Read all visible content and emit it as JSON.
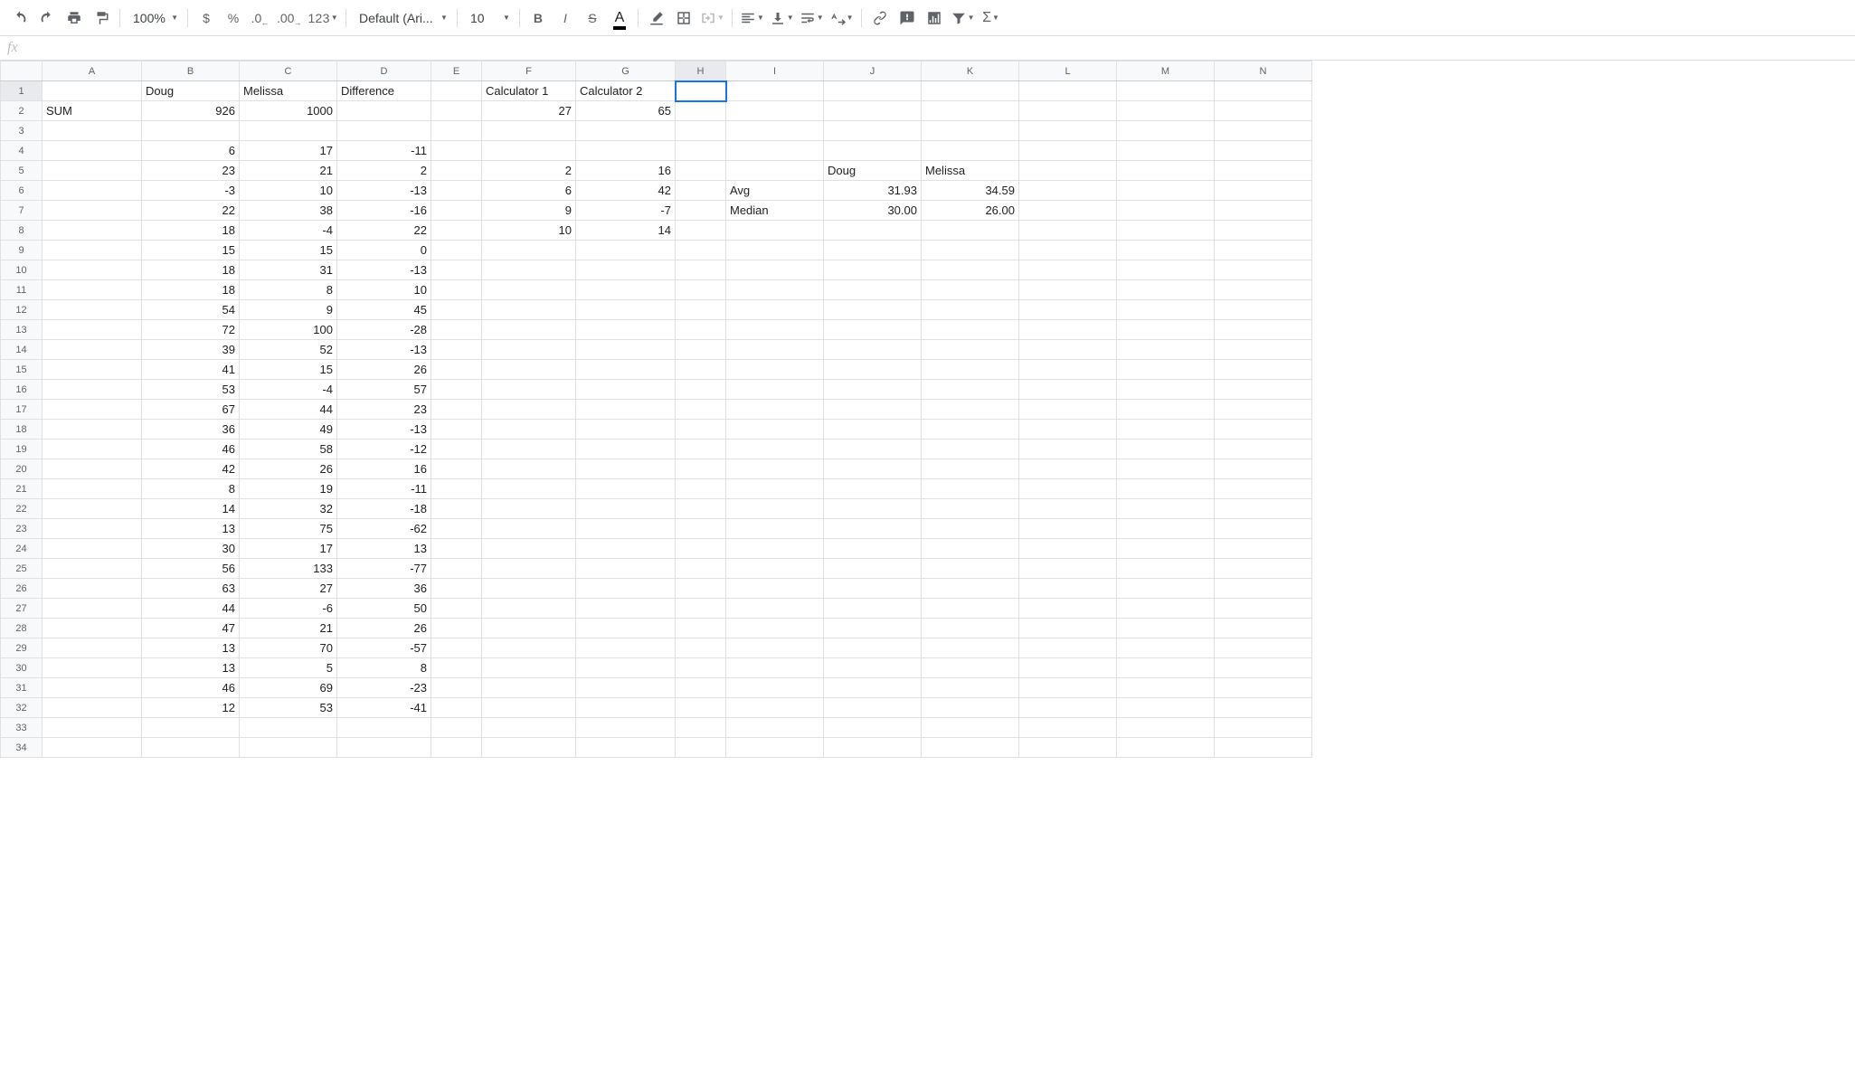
{
  "toolbar": {
    "zoom": "100%",
    "format123": "123",
    "font_name": "Default (Ari...",
    "font_size": "10"
  },
  "formula": {
    "fx_label": "fx",
    "value": ""
  },
  "columns": [
    "A",
    "B",
    "C",
    "D",
    "E",
    "F",
    "G",
    "H",
    "I",
    "J",
    "K",
    "L",
    "M",
    "N"
  ],
  "selected_col": "H",
  "selected_row": "1",
  "rows": [
    {
      "n": "1",
      "A": "",
      "B": "Doug",
      "C": "Melissa",
      "D": "Difference",
      "E": "",
      "F": "Calculator 1",
      "G": "Calculator 2",
      "H": "",
      "I": "",
      "J": "",
      "K": "",
      "L": "",
      "M": "",
      "N": "",
      "bold": [
        "B",
        "C",
        "D",
        "F",
        "G"
      ]
    },
    {
      "n": "2",
      "A": "SUM",
      "B": "926",
      "C": "1000",
      "D": "",
      "E": "",
      "F": "27",
      "G": "65",
      "H": "",
      "I": "",
      "J": "",
      "K": "",
      "L": "",
      "M": "",
      "N": "",
      "bold": [
        "A",
        "B",
        "C"
      ]
    },
    {
      "n": "3"
    },
    {
      "n": "4",
      "B": "6",
      "C": "17",
      "D": "-11"
    },
    {
      "n": "5",
      "B": "23",
      "C": "21",
      "D": "2",
      "F": "2",
      "G": "16",
      "J": "Doug",
      "K": "Melissa",
      "boldL": [
        "J",
        "K"
      ]
    },
    {
      "n": "6",
      "B": "-3",
      "C": "10",
      "D": "-13",
      "F": "6",
      "G": "42",
      "I": "Avg",
      "J": "31.93",
      "K": "34.59",
      "boldL": [
        "I"
      ]
    },
    {
      "n": "7",
      "B": "22",
      "C": "38",
      "D": "-16",
      "F": "9",
      "G": "-7",
      "I": "Median",
      "J": "30.00",
      "K": "26.00",
      "boldL": [
        "I"
      ]
    },
    {
      "n": "8",
      "B": "18",
      "C": "-4",
      "D": "22",
      "F": "10",
      "G": "14"
    },
    {
      "n": "9",
      "B": "15",
      "C": "15",
      "D": "0"
    },
    {
      "n": "10",
      "B": "18",
      "C": "31",
      "D": "-13"
    },
    {
      "n": "11",
      "B": "18",
      "C": "8",
      "D": "10"
    },
    {
      "n": "12",
      "B": "54",
      "C": "9",
      "D": "45"
    },
    {
      "n": "13",
      "B": "72",
      "C": "100",
      "D": "-28"
    },
    {
      "n": "14",
      "B": "39",
      "C": "52",
      "D": "-13"
    },
    {
      "n": "15",
      "B": "41",
      "C": "15",
      "D": "26"
    },
    {
      "n": "16",
      "B": "53",
      "C": "-4",
      "D": "57"
    },
    {
      "n": "17",
      "B": "67",
      "C": "44",
      "D": "23"
    },
    {
      "n": "18",
      "B": "36",
      "C": "49",
      "D": "-13"
    },
    {
      "n": "19",
      "B": "46",
      "C": "58",
      "D": "-12"
    },
    {
      "n": "20",
      "B": "42",
      "C": "26",
      "D": "16"
    },
    {
      "n": "21",
      "B": "8",
      "C": "19",
      "D": "-11"
    },
    {
      "n": "22",
      "B": "14",
      "C": "32",
      "D": "-18"
    },
    {
      "n": "23",
      "B": "13",
      "C": "75",
      "D": "-62"
    },
    {
      "n": "24",
      "B": "30",
      "C": "17",
      "D": "13"
    },
    {
      "n": "25",
      "B": "56",
      "C": "133",
      "D": "-77"
    },
    {
      "n": "26",
      "B": "63",
      "C": "27",
      "D": "36"
    },
    {
      "n": "27",
      "B": "44",
      "C": "-6",
      "D": "50"
    },
    {
      "n": "28",
      "B": "47",
      "C": "21",
      "D": "26"
    },
    {
      "n": "29",
      "B": "13",
      "C": "70",
      "D": "-57"
    },
    {
      "n": "30",
      "B": "13",
      "C": "5",
      "D": "8"
    },
    {
      "n": "31",
      "B": "46",
      "C": "69",
      "D": "-23"
    },
    {
      "n": "32",
      "B": "12",
      "C": "53",
      "D": "-41"
    },
    {
      "n": "33"
    },
    {
      "n": "34"
    }
  ],
  "numeric_cols": [
    "B",
    "C",
    "D",
    "F",
    "G",
    "J",
    "K"
  ],
  "left_text_cells": [
    "1.B",
    "1.C",
    "1.D",
    "1.F",
    "1.G",
    "2.A",
    "5.J",
    "5.K",
    "6.I",
    "7.I"
  ]
}
